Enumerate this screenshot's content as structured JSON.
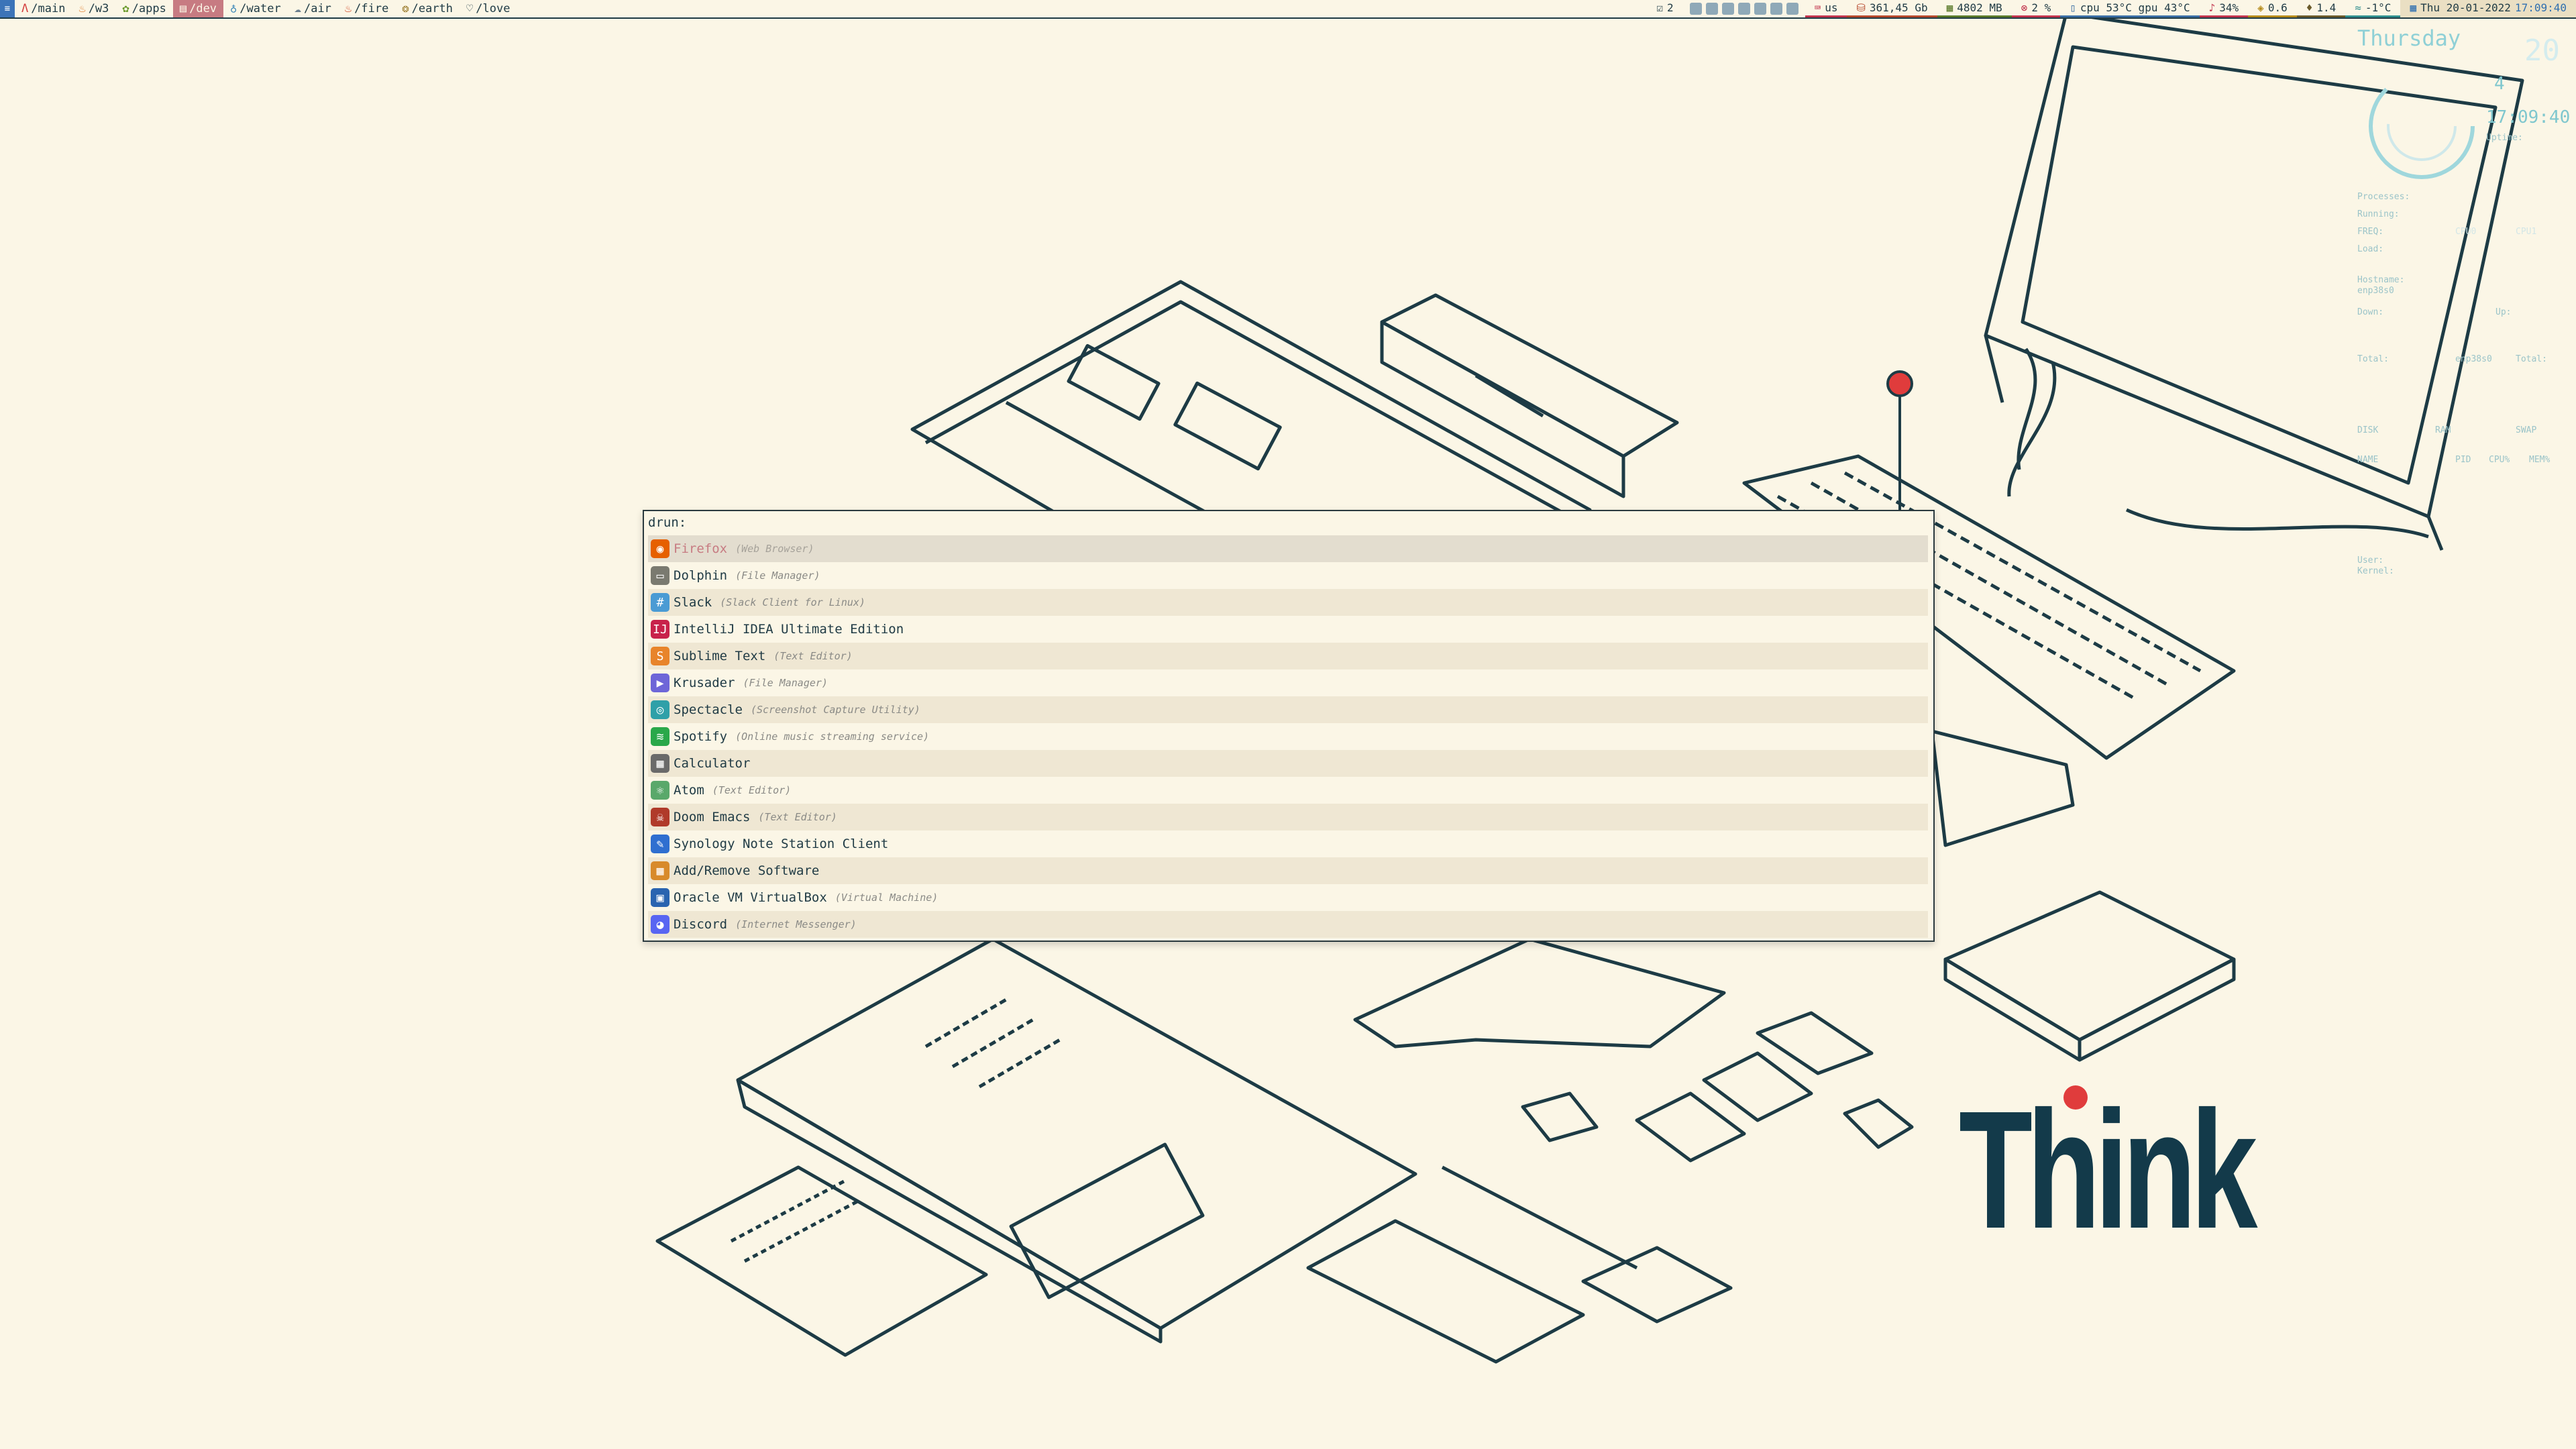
{
  "topbar": {
    "launcher_icon": "menu-icon",
    "workspaces": [
      {
        "glyph": "Λ",
        "label": "/main",
        "color": "#d33b3b",
        "active": false
      },
      {
        "glyph": "♨",
        "label": "/w3",
        "color": "#e07b2a",
        "active": false
      },
      {
        "glyph": "✿",
        "label": "/apps",
        "color": "#6a9a2c",
        "active": false
      },
      {
        "glyph": "▤",
        "label": "/dev",
        "color": "#b3325a",
        "active": true
      },
      {
        "glyph": "♁",
        "label": "/water",
        "color": "#2f7fb5",
        "active": false
      },
      {
        "glyph": "☁",
        "label": "/air",
        "color": "#6b7f8f",
        "active": false
      },
      {
        "glyph": "♨",
        "label": "/fire",
        "color": "#d0421f",
        "active": false
      },
      {
        "glyph": "❂",
        "label": "/earth",
        "color": "#9a7a2a",
        "active": false
      },
      {
        "glyph": "♡",
        "label": "/love",
        "color": "#1f3a44",
        "active": false
      }
    ],
    "notif_count": "2",
    "modules": [
      {
        "name": "keyboard-layout",
        "icon": "⌨",
        "text": "us",
        "color": "#c2344d"
      },
      {
        "name": "disk",
        "icon": "⛁",
        "text": "361,45 Gb",
        "color": "#b5482c"
      },
      {
        "name": "memory",
        "icon": "▦",
        "text": "4802 MB",
        "color": "#5a7a2a"
      },
      {
        "name": "updates",
        "icon": "⊗",
        "text": "2 %",
        "color": "#c2344d"
      },
      {
        "name": "temps",
        "icon": "▯",
        "text": "cpu 53°C gpu 43°C",
        "color": "#3a6ea5"
      },
      {
        "name": "volume",
        "icon": "♪",
        "text": "34%",
        "color": "#c2344d"
      },
      {
        "name": "load",
        "icon": "◈",
        "text": "0.6",
        "color": "#b58b1a"
      },
      {
        "name": "battery",
        "icon": "♦",
        "text": "1.4",
        "color": "#6a5a2a"
      },
      {
        "name": "weather",
        "icon": "≈",
        "text": "-1°C",
        "color": "#2f8f8f"
      }
    ],
    "clock": {
      "icon": "▦",
      "text": "Thu 20-01-2022",
      "time": "17:09:40",
      "color": "#2f6fb0"
    }
  },
  "conky": {
    "day": "Thursday",
    "date_big": "20",
    "date_num": "4",
    "time": "17:09:40",
    "uptime_label": "Uptime:",
    "processes_label": "Processes:",
    "running_label": "Running:",
    "freq_label": "FREQ:",
    "load_label": "Load:",
    "cpu0": "CPU0",
    "cpu1": "CPU1",
    "hostname_label": "Hostname:",
    "hostname_value": "enp38s0",
    "down_label": "Down:",
    "up_label": "Up:",
    "total_label": "Total:",
    "total_iface": "enp38s0",
    "total_right": "Total:",
    "disk_label": "DISK",
    "ram_label": "RAM",
    "swap_label": "SWAP",
    "name_label": "NAME",
    "pid_label": "PID",
    "cpu_label": "CPU%",
    "mem_label": "MEM%",
    "user_label": "User:",
    "kernel_label": "Kernel:"
  },
  "wallpaper": {
    "logo_text": "Think",
    "accent": "#e03c3c"
  },
  "rofi": {
    "prompt": "drun:",
    "input_value": "",
    "items": [
      {
        "name": "Firefox",
        "desc": "(Web Browser)",
        "icon": "firefox-icon",
        "icon_color": "#e66000",
        "glyph": "◉"
      },
      {
        "name": "Dolphin",
        "desc": "(File Manager)",
        "icon": "dolphin-icon",
        "icon_color": "#7a7a70",
        "glyph": "▭"
      },
      {
        "name": "Slack",
        "desc": "(Slack Client for Linux)",
        "icon": "slack-icon",
        "icon_color": "#4a9bd4",
        "glyph": "#"
      },
      {
        "name": "IntelliJ IDEA Ultimate Edition",
        "desc": "",
        "icon": "intellij-icon",
        "icon_color": "#c8224a",
        "glyph": "IJ"
      },
      {
        "name": "Sublime Text",
        "desc": "(Text Editor)",
        "icon": "sublime-icon",
        "icon_color": "#e8842a",
        "glyph": "S"
      },
      {
        "name": "Krusader",
        "desc": "(File Manager)",
        "icon": "krusader-icon",
        "icon_color": "#6e66d8",
        "glyph": "▶"
      },
      {
        "name": "Spectacle",
        "desc": "(Screenshot Capture Utility)",
        "icon": "spectacle-icon",
        "icon_color": "#2fa0a8",
        "glyph": "◎"
      },
      {
        "name": "Spotify",
        "desc": "(Online music streaming service)",
        "icon": "spotify-icon",
        "icon_color": "#2aa84a",
        "glyph": "≋"
      },
      {
        "name": "Calculator",
        "desc": "",
        "icon": "calculator-icon",
        "icon_color": "#6a6a6a",
        "glyph": "▦"
      },
      {
        "name": "Atom",
        "desc": "(Text Editor)",
        "icon": "atom-icon",
        "icon_color": "#5aa86a",
        "glyph": "⚛"
      },
      {
        "name": "Doom Emacs",
        "desc": "(Text Editor)",
        "icon": "doom-emacs-icon",
        "icon_color": "#b03a2a",
        "glyph": "☠"
      },
      {
        "name": "Synology Note Station Client",
        "desc": "",
        "icon": "synology-note-icon",
        "icon_color": "#2f6fd0",
        "glyph": "✎"
      },
      {
        "name": "Add/Remove Software",
        "desc": "",
        "icon": "add-remove-software-icon",
        "icon_color": "#d88a2a",
        "glyph": "▦"
      },
      {
        "name": "Oracle VM VirtualBox",
        "desc": "(Virtual Machine)",
        "icon": "virtualbox-icon",
        "icon_color": "#2a64b0",
        "glyph": "▣"
      },
      {
        "name": "Discord",
        "desc": "(Internet Messenger)",
        "icon": "discord-icon",
        "icon_color": "#5865f2",
        "glyph": "◕"
      }
    ]
  }
}
